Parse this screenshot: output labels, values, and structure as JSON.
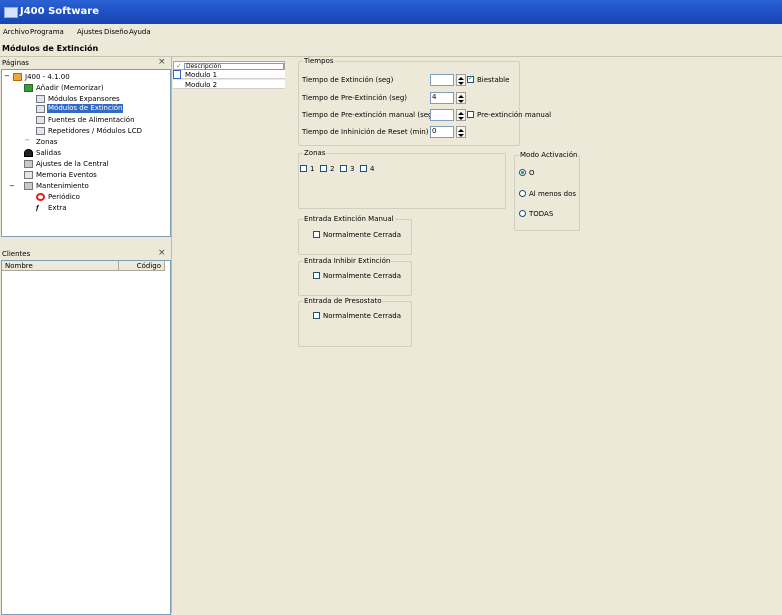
{
  "app": {
    "title": "J400 Software"
  },
  "menu": [
    "Archivo",
    "Programa",
    "Ajustes",
    "Diseño",
    "Ayuda"
  ],
  "page_header": "Módulos de Extinción",
  "paginas_panel": {
    "title": "Páginas",
    "close": "×",
    "tree": {
      "root": "J400 - 4.1.00",
      "anadir": "Añadir (Memorizar)",
      "expansores": "Módulos Expansores",
      "extincion": "Módulos de Extinción",
      "fuentes": "Fuentes de Alimentación",
      "repetidores": "Repetidores / Módulos LCD",
      "zonas": "Zonas",
      "salidas": "Salidas",
      "ajustes_central": "Ajustes de la Central",
      "memoria": "Memoria Eventos",
      "mantenimiento": "Mantenimiento",
      "periodico": "Periódico",
      "extra": "Extra",
      "expand": "−"
    }
  },
  "clientes_panel": {
    "title": "Clientes",
    "close": "×",
    "columns": [
      "Nombre",
      "Código"
    ]
  },
  "grid": {
    "header": "Descripción",
    "rows": [
      "Modulo 1",
      "Modulo 2"
    ]
  },
  "tiempos": {
    "title": "Tiempos",
    "fields": [
      {
        "label": "Tiempo de Extinción (seg)",
        "value": ""
      },
      {
        "label": "Tiempo de Pre-Extinción (seg)",
        "value": "4"
      },
      {
        "label": "Tiempo de Pre-extinción manual (seg)",
        "value": ""
      },
      {
        "label": "Tiempo de Inhinición de Reset (min)",
        "value": "0"
      }
    ],
    "biestable": {
      "label": "Biestable",
      "checked": true
    },
    "preext_manual": {
      "label": "Pre-extinción manual",
      "checked": false
    }
  },
  "zonas": {
    "title": "Zonas",
    "items": [
      "1",
      "2",
      "3",
      "4"
    ]
  },
  "modo": {
    "title": "Modo Activación",
    "options": [
      {
        "label": "O",
        "selected": true
      },
      {
        "label": "Al menos dos",
        "selected": false
      },
      {
        "label": "TODAS",
        "selected": false
      }
    ]
  },
  "entradas": [
    {
      "title": "Entrada Extinción Manual",
      "option": "Normalmente Cerrada"
    },
    {
      "title": "Entrada Inhibir Extinción",
      "option": "Normalmente Cerrada"
    },
    {
      "title": "Entrada de Presostato",
      "option": "Normalmente Cerrada"
    }
  ],
  "colors": {
    "titlebar": "#1f51c4",
    "selection": "#316ac5",
    "background": "#ece9d8",
    "border": "#7f9db9"
  }
}
